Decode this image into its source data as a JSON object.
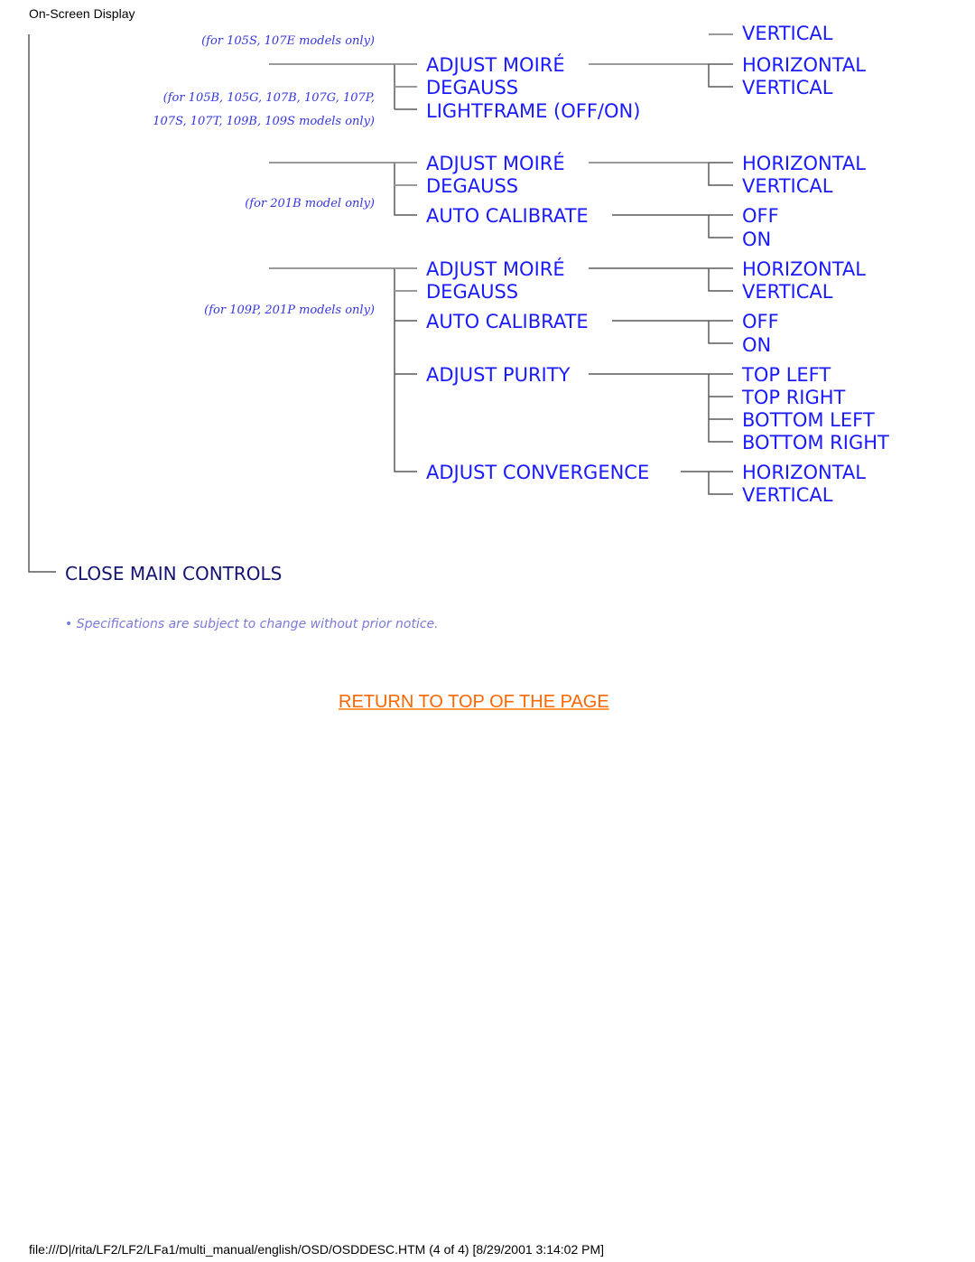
{
  "header": {
    "title": "On-Screen Display"
  },
  "diagram": {
    "groups": [
      {
        "note_top": "(for 105S, 107E models only)",
        "note": [
          "(for 105B, 105G, 107B, 107G, 107P,",
          "107S, 107T, 109B, 109S models only)"
        ],
        "items": [
          {
            "label": "ADJUST MOIRÉ",
            "children": [
              "HORIZONTAL",
              "VERTICAL"
            ]
          },
          {
            "label": "DEGAUSS",
            "children": []
          },
          {
            "label": "LIGHTFRAME (OFF/ON)",
            "children": []
          }
        ],
        "partial_top_label": "VERTICAL"
      },
      {
        "note": [
          "(for 201B model only)"
        ],
        "items": [
          {
            "label": "ADJUST MOIRÉ",
            "children": [
              "HORIZONTAL",
              "VERTICAL"
            ]
          },
          {
            "label": "DEGAUSS",
            "children": []
          },
          {
            "label": "AUTO CALIBRATE",
            "children": [
              "OFF",
              "ON"
            ]
          }
        ]
      },
      {
        "note": [
          "(for 109P, 201P models only)"
        ],
        "items": [
          {
            "label": "ADJUST MOIRÉ",
            "children": [
              "HORIZONTAL",
              "VERTICAL"
            ]
          },
          {
            "label": "DEGAUSS",
            "children": []
          },
          {
            "label": "AUTO CALIBRATE",
            "children": [
              "OFF",
              "ON"
            ]
          },
          {
            "label": "ADJUST PURITY",
            "children": [
              "TOP LEFT",
              "TOP RIGHT",
              "BOTTOM LEFT",
              "BOTTOM RIGHT"
            ]
          },
          {
            "label": "ADJUST CONVERGENCE",
            "children": [
              "HORIZONTAL",
              "VERTICAL"
            ]
          }
        ]
      }
    ],
    "close_label": "CLOSE MAIN CONTROLS",
    "disclaimer": "• Specifications are subject to change without prior notice."
  },
  "links": {
    "return_top": "RETURN TO TOP OF THE PAGE"
  },
  "footer": {
    "path": "file:///D|/rita/LF2/LF2/LFa1/multi_manual/english/OSD/OSDDESC.HTM (4 of 4) [8/29/2001 3:14:02 PM]"
  },
  "colors": {
    "label": "#1a1aff",
    "close_label": "#141470",
    "link": "#ff6600"
  }
}
